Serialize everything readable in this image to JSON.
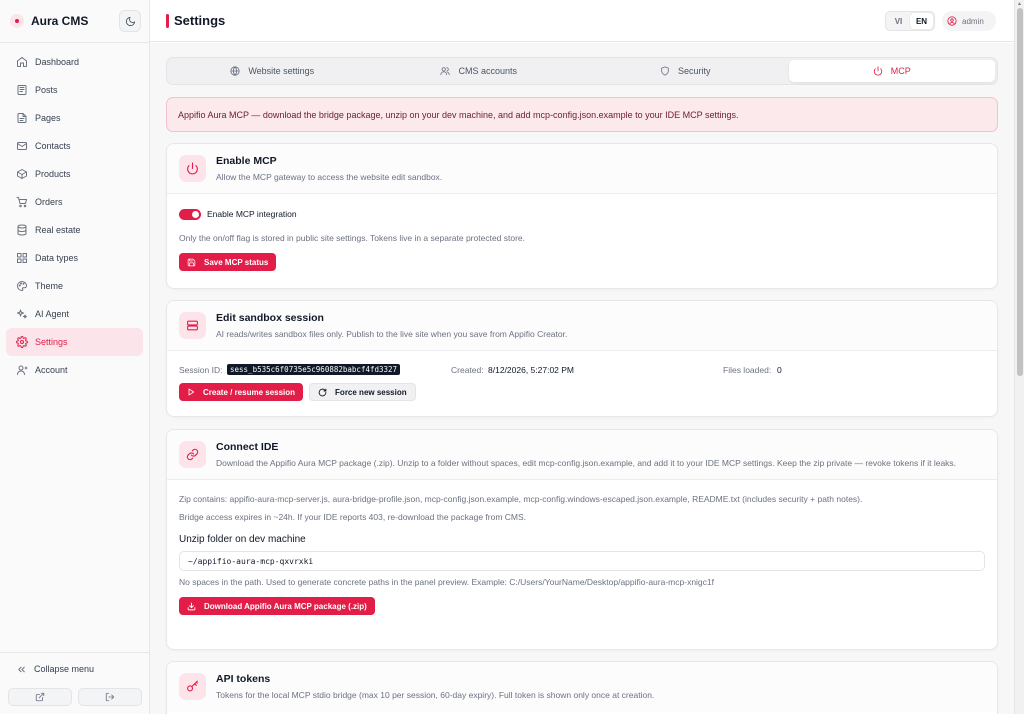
{
  "app": {
    "name": "Aura CMS"
  },
  "sidebar": {
    "items": [
      {
        "label": "Dashboard",
        "icon": "home-icon"
      },
      {
        "label": "Posts",
        "icon": "newspaper-icon"
      },
      {
        "label": "Pages",
        "icon": "file-icon"
      },
      {
        "label": "Contacts",
        "icon": "mail-icon"
      },
      {
        "label": "Products",
        "icon": "box-icon"
      },
      {
        "label": "Orders",
        "icon": "cart-icon"
      },
      {
        "label": "Real estate",
        "icon": "database-icon"
      },
      {
        "label": "Data types",
        "icon": "grid-icon"
      },
      {
        "label": "Theme",
        "icon": "palette-icon"
      },
      {
        "label": "AI Agent",
        "icon": "sparkles-icon"
      },
      {
        "label": "Settings",
        "icon": "gear-icon",
        "active": true
      },
      {
        "label": "Account",
        "icon": "user-icon"
      }
    ],
    "collapse_label": "Collapse menu"
  },
  "header": {
    "title": "Settings",
    "languages": [
      "VI",
      "EN"
    ],
    "active_language": "EN",
    "user": "admin"
  },
  "tabs": [
    {
      "label": "Website settings",
      "icon": "globe-icon"
    },
    {
      "label": "CMS accounts",
      "icon": "users-icon"
    },
    {
      "label": "Security",
      "icon": "shield-icon"
    },
    {
      "label": "MCP",
      "icon": "power-icon",
      "active": true
    }
  ],
  "alert": "Appifio Aura MCP — download the bridge package, unzip on your dev machine, and add mcp-config.json.example to your IDE MCP settings.",
  "enable_mcp": {
    "title": "Enable MCP",
    "subtitle": "Allow the MCP gateway to access the website edit sandbox.",
    "toggle_label": "Enable MCP integration",
    "toggle_on": true,
    "note": "Only the on/off flag is stored in public site settings. Tokens live in a separate protected store.",
    "save_label": "Save MCP status"
  },
  "sandbox": {
    "title": "Edit sandbox session",
    "subtitle": "AI reads/writes sandbox files only. Publish to the live site when you save from Appifio Creator.",
    "session_label": "Session ID:",
    "session_id": "sess_b535c6f0735e5c960882babcf4fd3327",
    "created_label": "Created:",
    "created_value": "8/12/2026, 5:27:02 PM",
    "files_label": "Files loaded:",
    "files_value": "0",
    "create_label": "Create / resume session",
    "force_label": "Force new session"
  },
  "connect_ide": {
    "title": "Connect IDE",
    "subtitle": "Download the Appifio Aura MCP package (.zip). Unzip to a folder without spaces, edit mcp-config.json.example, and add it to your IDE MCP settings. Keep the zip private — revoke tokens if it leaks.",
    "zip_contains": "Zip contains: appifio-aura-mcp-server.js, aura-bridge-profile.json, mcp-config.json.example, mcp-config.windows-escaped.json.example, README.txt (includes security + path notes).",
    "expires": "Bridge access expires in ~24h. If your IDE reports 403, re-download the package from CMS.",
    "folder_label": "Unzip folder on dev machine",
    "folder_value": "~/appifio-aura-mcp-qxvrxki",
    "folder_hint": "No spaces in the path. Used to generate concrete paths in the panel preview. Example: C:/Users/YourName/Desktop/appifio-aura-mcp-xnigc1f",
    "download_label": "Download Appifio Aura MCP package (.zip)"
  },
  "api_tokens": {
    "title": "API tokens",
    "subtitle": "Tokens for the local MCP stdio bridge (max 10 per session, 60-day expiry). Full token is shown only once at creation."
  },
  "colors": {
    "accent": "#e11d48",
    "accent_soft": "#fce4ea",
    "alert_bg": "#fce9ec"
  }
}
